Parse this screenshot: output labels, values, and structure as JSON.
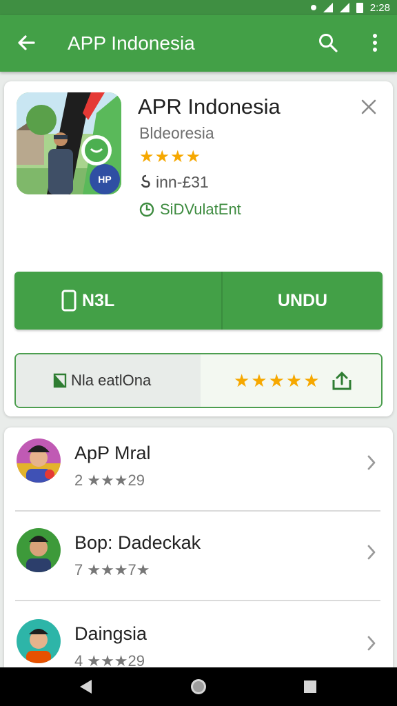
{
  "status_bar": {
    "time": "2:28"
  },
  "app_bar": {
    "title": "APP Indonesia"
  },
  "app": {
    "name": "APR Indonesia",
    "developer": "Bldeoresia",
    "rating_stars": "★★★★",
    "installs_prefix": "inn-£31",
    "verified_text": "SiDVulatEnt",
    "icon_badge": "HP"
  },
  "actions": {
    "left_label": "N3L",
    "right_label": "UNDU"
  },
  "info": {
    "left_label": "Nla eatlOna",
    "stars": "★★★★★"
  },
  "list": [
    {
      "name": "ApP Mral",
      "sub": "2 ★★★29",
      "avatar_bg": "#c05ab4"
    },
    {
      "name": "Bop: Dadeckak",
      "sub": "7 ★★★7★",
      "avatar_bg": "#3d9a3a"
    },
    {
      "name": "Daingsia",
      "sub": "4 ★★★29",
      "avatar_bg": "#2db5a8"
    }
  ],
  "colors": {
    "primary": "#43a047",
    "star": "#f6a800"
  }
}
